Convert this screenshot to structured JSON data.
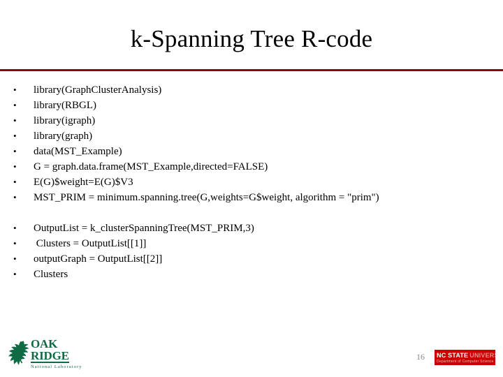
{
  "slide": {
    "title": "k-Spanning Tree R-code",
    "page_number": "16",
    "accent_color": "#990000",
    "bullet_glyph": "•"
  },
  "code_lines": [
    {
      "text": "library(GraphClusterAnalysis)",
      "bullet": true
    },
    {
      "text": "library(RBGL)",
      "bullet": true
    },
    {
      "text": "library(igraph)",
      "bullet": true
    },
    {
      "text": "library(graph)",
      "bullet": true
    },
    {
      "text": "data(MST_Example)",
      "bullet": true
    },
    {
      "text": "G = graph.data.frame(MST_Example,directed=FALSE)",
      "bullet": true
    },
    {
      "text": "E(G)$weight=E(G)$V3",
      "bullet": true
    },
    {
      "text": "MST_PRIM = minimum.spanning.tree(G,weights=G$weight, algorithm = \"prim\")",
      "bullet": true
    },
    {
      "text": "",
      "bullet": false
    },
    {
      "text": "OutputList = k_clusterSpanningTree(MST_PRIM,3)",
      "bullet": true
    },
    {
      "text": " Clusters = OutputList[[1]]",
      "bullet": true
    },
    {
      "text": "outputGraph = OutputList[[2]]",
      "bullet": true
    },
    {
      "text": "Clusters",
      "bullet": true
    }
  ],
  "ornl_logo": {
    "line1": "OAK",
    "line2": "RIDGE",
    "line3": "National Laboratory",
    "color": "#0E6B43"
  },
  "ncsu_logo": {
    "name_bold": "NC STATE",
    "name_light": "UNIVERSITY",
    "department": "Department of Computer Science",
    "color": "#CC0000"
  }
}
